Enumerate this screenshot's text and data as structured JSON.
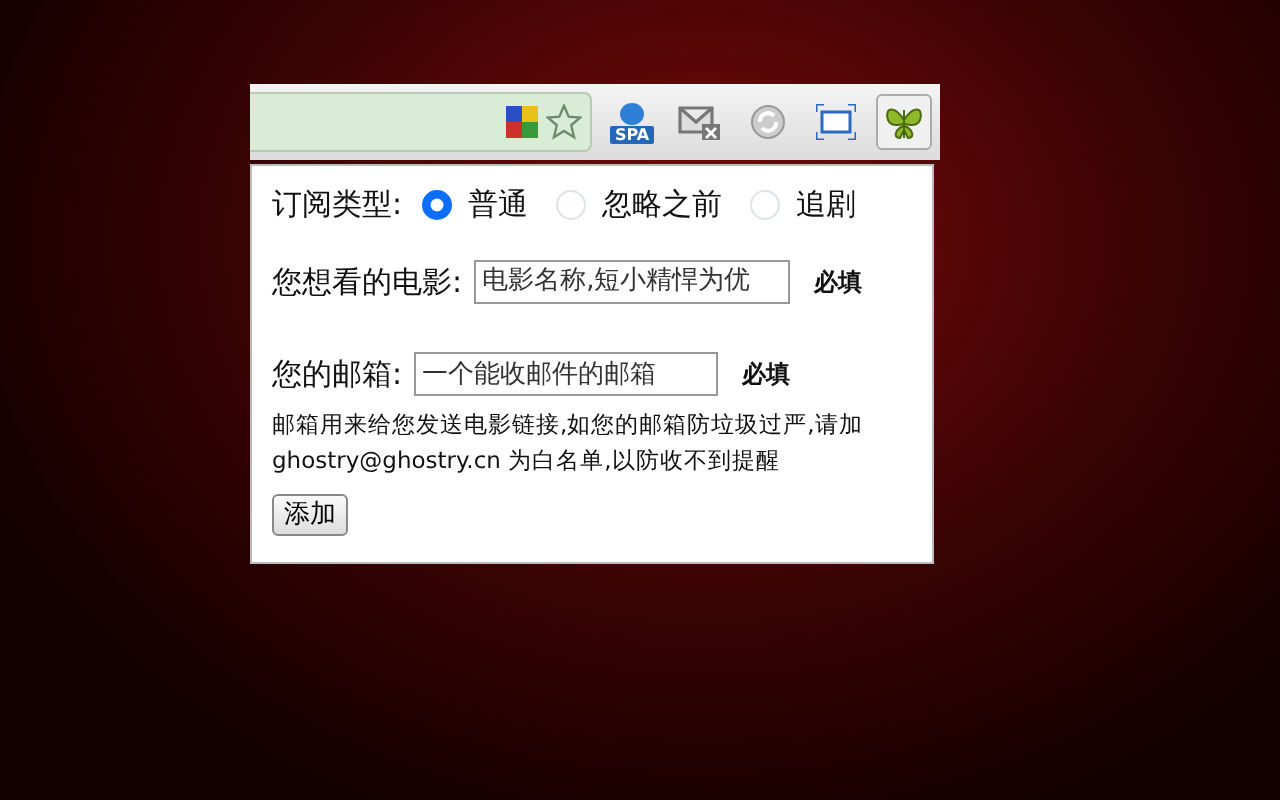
{
  "toolbar": {
    "spa_badge": "SPA",
    "extension_active": true
  },
  "form": {
    "type_label": "订阅类型:",
    "type_options": [
      {
        "label": "普通",
        "selected": true
      },
      {
        "label": "忽略之前",
        "selected": false
      },
      {
        "label": "追剧",
        "selected": false
      }
    ],
    "movie": {
      "label": "您想看的电影:",
      "placeholder": "电影名称,短小精悍为优",
      "required": "必填"
    },
    "email": {
      "label": "您的邮箱:",
      "placeholder": "一个能收邮件的邮箱",
      "required": "必填"
    },
    "note": "邮箱用来给您发送电影链接,如您的邮箱防垃圾过严,请加 ghostry@ghostry.cn 为白名单,以防收不到提醒",
    "submit": "添加"
  }
}
